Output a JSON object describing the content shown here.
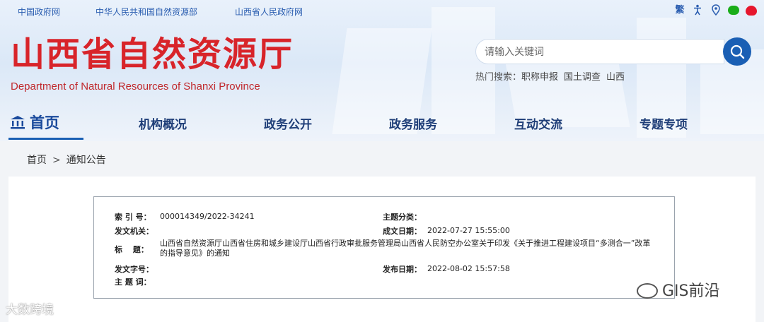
{
  "top_links": [
    "中国政府网",
    "中华人民共和国自然资源部",
    "山西省人民政府网"
  ],
  "utility_icons": {
    "traditional": "繁",
    "accessibility": "accessibility-icon",
    "location": "map-pin-icon",
    "wechat": "wechat-icon",
    "weibo": "weibo-icon"
  },
  "site": {
    "name_cn": "山西省自然资源厅",
    "name_en": "Department of Natural Resources of Shanxi Province"
  },
  "search": {
    "placeholder": "请输入关键词",
    "hot_label": "热门搜索：",
    "hot_terms": [
      "职称申报",
      "国土调查",
      "山西"
    ]
  },
  "nav": {
    "home": "首页",
    "items": [
      "机构概况",
      "政务公开",
      "政务服务",
      "互动交流",
      "专题专项"
    ]
  },
  "breadcrumb": {
    "home": "首页",
    "sep": ">",
    "current": "通知公告"
  },
  "document_meta": {
    "index_label": "索 引 号：",
    "index_value": "000014349/2022-34241",
    "category_label": "主题分类：",
    "issuer_label": "发文机关：",
    "created_label": "成文日期：",
    "created_value": "2022-07-27 15:55:00",
    "title_label": "标　 题：",
    "title_value": "山西省自然资源厅山西省住房和城乡建设厅山西省行政审批服务管理局山西省人民防空办公室关于印发《关于推进工程建设项目“多测合一”改革的指导意见》的通知",
    "docno_label": "发文字号：",
    "published_label": "发布日期：",
    "published_value": "2022-08-02 15:57:58",
    "keywords_label": "主 题 词："
  },
  "watermarks": {
    "left": "大数跨境",
    "right": "GIS前沿"
  },
  "colors": {
    "brand_red": "#d8242a",
    "nav_blue": "#1a5fb4",
    "link_blue": "#2a5db0"
  }
}
